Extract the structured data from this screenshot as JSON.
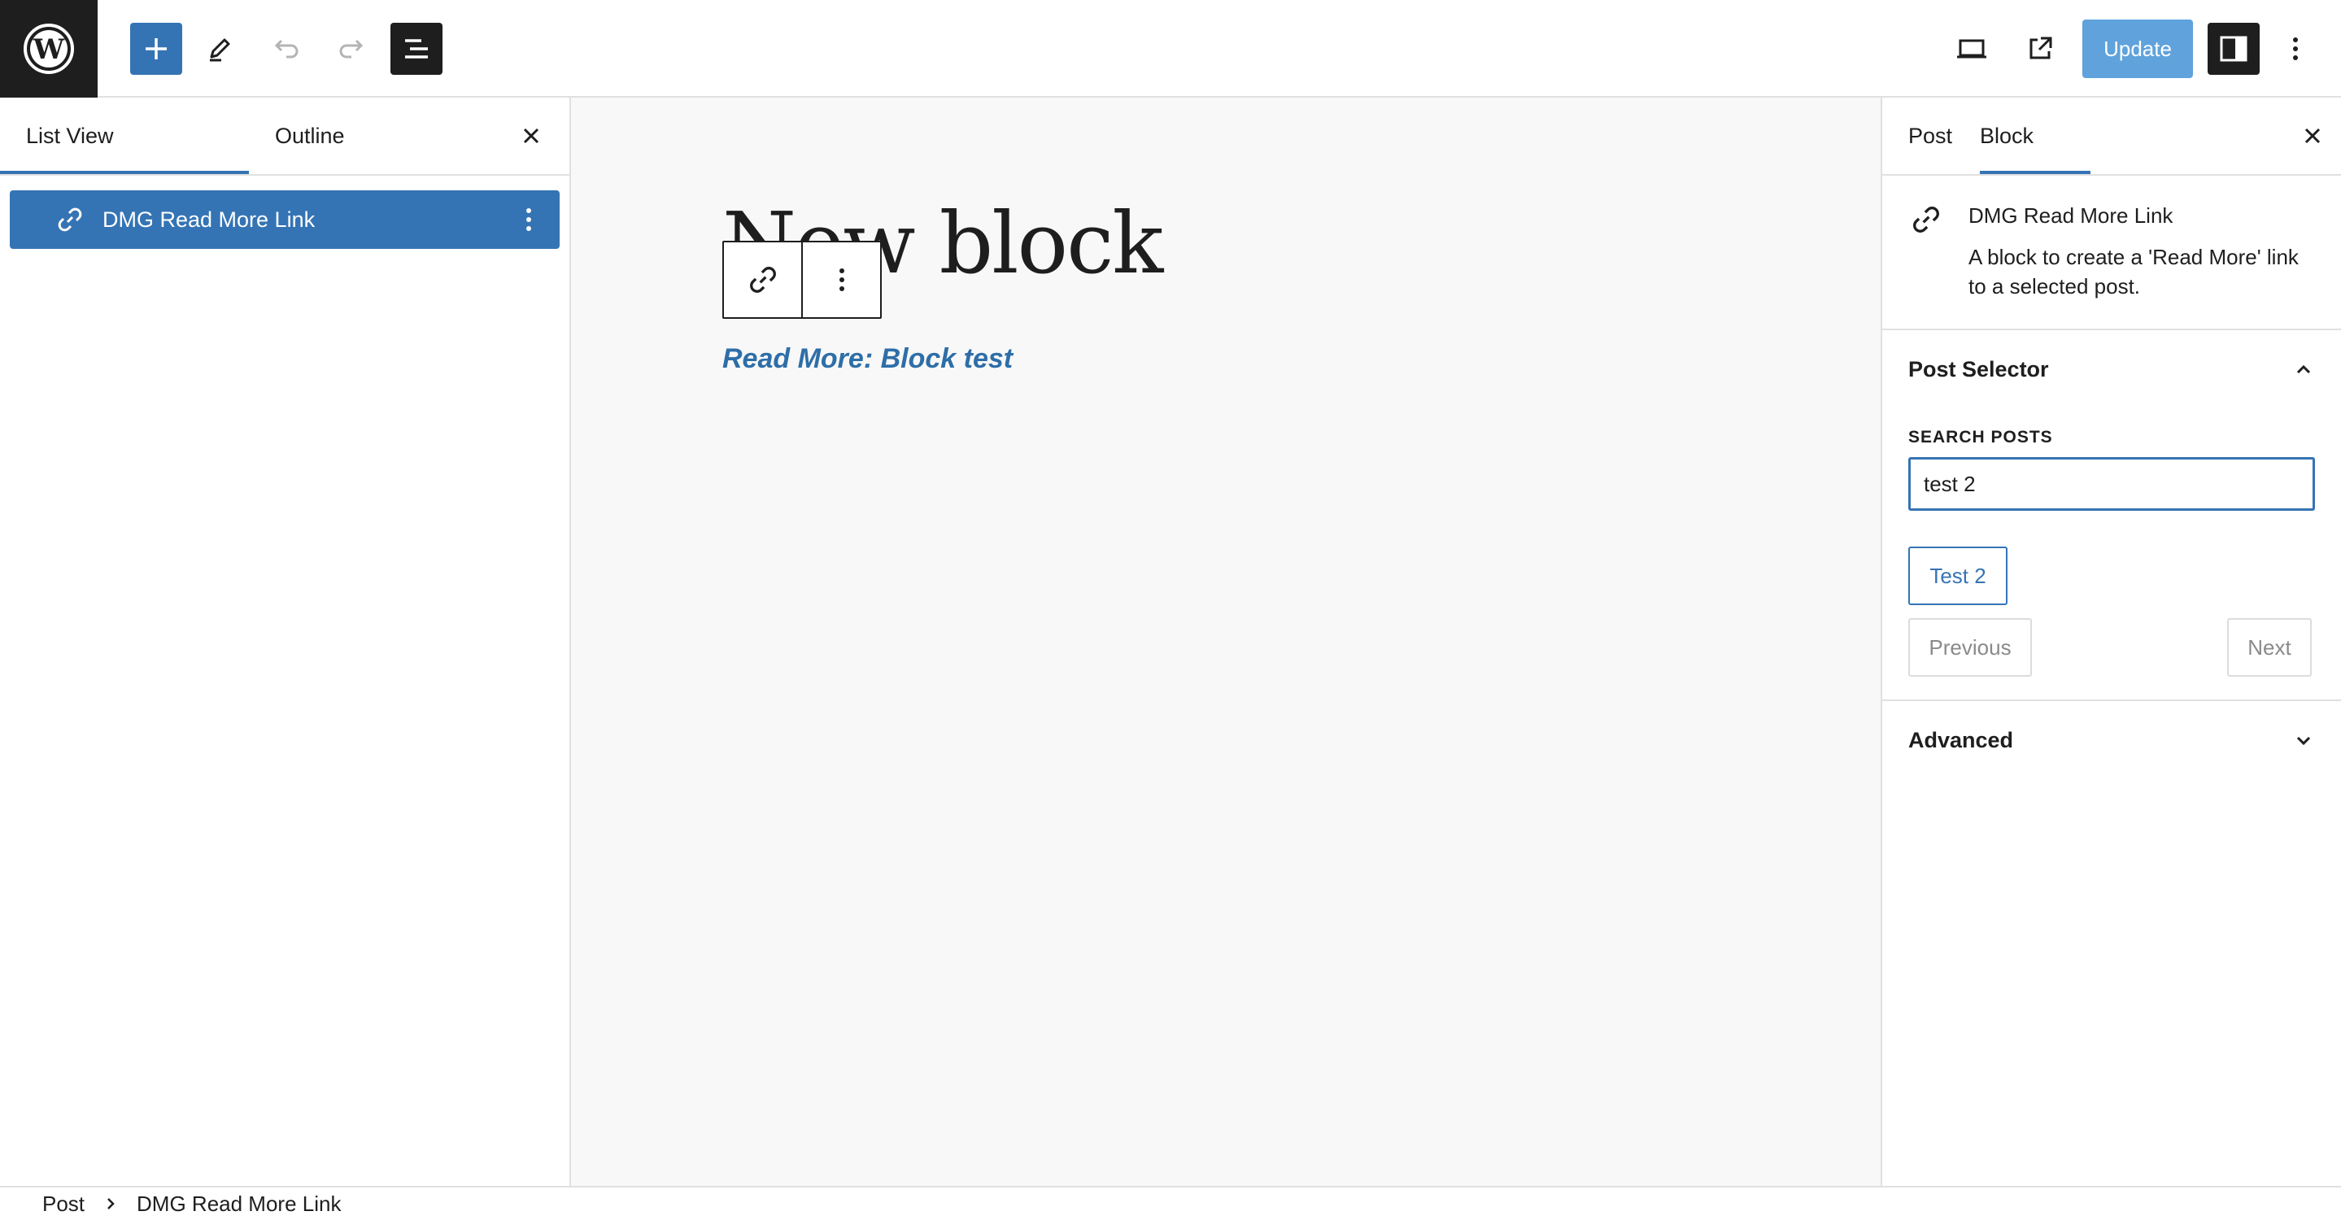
{
  "topbar": {
    "logo_icon": "wordpress-logo-icon",
    "add_icon": "plus-icon",
    "edit_icon": "pencil-icon",
    "undo_icon": "undo-icon",
    "redo_icon": "redo-icon",
    "listview_icon": "list-view-icon",
    "view_icon": "desktop-view-icon",
    "preview_icon": "external-link-icon",
    "update_label": "Update",
    "settings_icon": "sidebar-toggle-icon",
    "options_icon": "more-vertical-icon"
  },
  "left_panel": {
    "tabs": [
      {
        "label": "List View",
        "active": true
      },
      {
        "label": "Outline",
        "active": false
      }
    ],
    "items": [
      {
        "label": "DMG Read More Link",
        "icon": "link-icon",
        "selected": true
      }
    ]
  },
  "canvas": {
    "post_title": "New block",
    "block_toolbar": {
      "block_icon": "link-icon",
      "options_icon": "more-vertical-icon"
    },
    "read_more_text": "Read More: Block test"
  },
  "sidebar": {
    "tabs": [
      {
        "label": "Post",
        "active": false
      },
      {
        "label": "Block",
        "active": true
      }
    ],
    "block_card": {
      "icon": "link-icon",
      "title": "DMG Read More Link",
      "description": "A block to create a 'Read More' link to a selected post."
    },
    "post_selector": {
      "title": "Post Selector",
      "expanded": true,
      "search_label": "SEARCH POSTS",
      "search_value": "test 2",
      "results": [
        "Test 2"
      ],
      "previous_label": "Previous",
      "next_label": "Next"
    },
    "advanced": {
      "title": "Advanced",
      "expanded": false
    }
  },
  "footer": {
    "breadcrumb": [
      "Post",
      "DMG Read More Link"
    ]
  },
  "colors": {
    "accent": "#3574b4",
    "update_button": "#5fa2dc",
    "dark": "#1e1e1e",
    "link_text": "#2e6ea8",
    "canvas_bg": "#f8f8f8"
  }
}
